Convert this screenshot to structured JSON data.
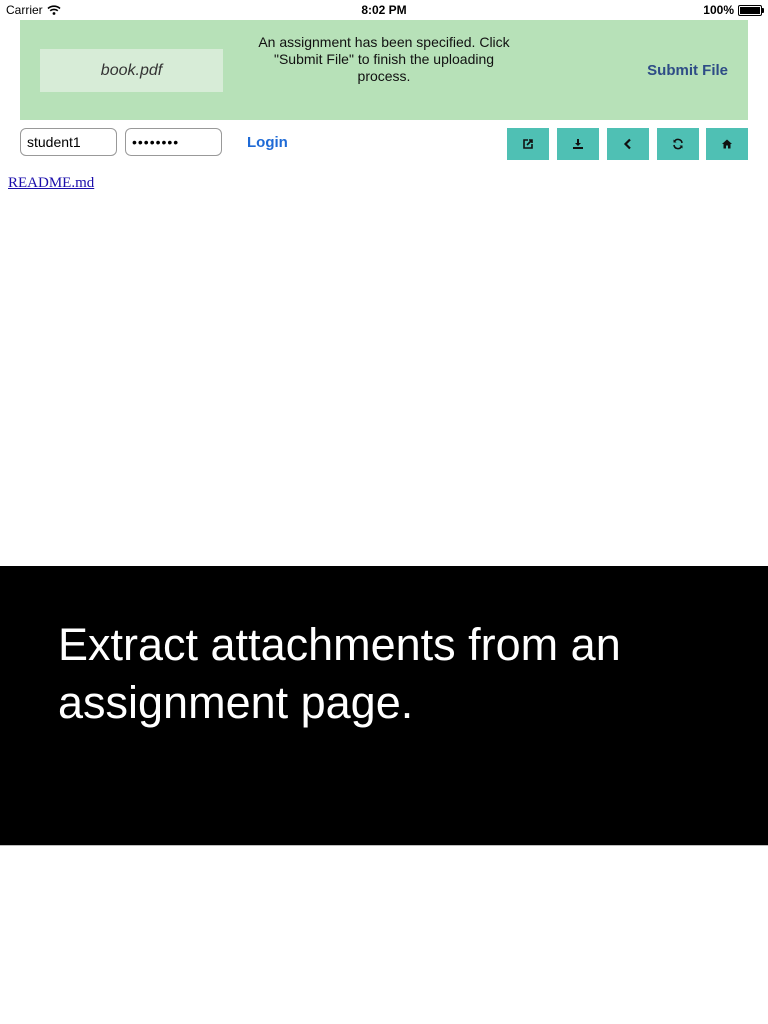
{
  "status_bar": {
    "carrier": "Carrier",
    "wifi_icon": "wifi-icon",
    "time": "8:02 PM",
    "battery_percent": "100%",
    "battery_icon": "battery-icon",
    "battery_level": 1.0
  },
  "banner": {
    "file_name": "book.pdf",
    "message": "An assignment has been specified. Click \"Submit File\" to finish the uploading process.",
    "submit_label": "Submit File",
    "background_color": "#b7e1b8"
  },
  "login": {
    "username_value": "student1",
    "password_value": "••••••••",
    "login_label": "Login",
    "link_color": "#1e6ad6"
  },
  "toolbar": {
    "button_color": "#4fc0b4",
    "buttons": [
      {
        "icon": "share-icon"
      },
      {
        "icon": "download-icon"
      },
      {
        "icon": "back-icon"
      },
      {
        "icon": "refresh-icon"
      },
      {
        "icon": "home-icon"
      }
    ]
  },
  "content": {
    "readme_link": "README.md"
  },
  "caption": {
    "text": "Extract attachments from an assignment page."
  }
}
